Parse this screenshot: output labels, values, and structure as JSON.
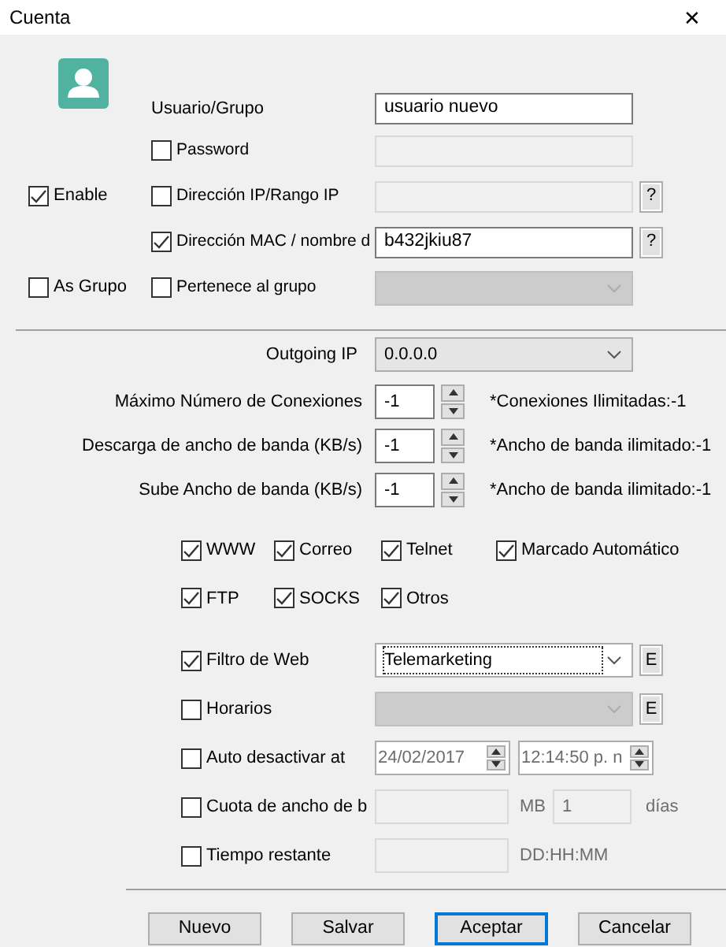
{
  "window": {
    "title": "Cuenta",
    "close": "✕"
  },
  "top_rows": [
    {
      "kind": "user",
      "label": "Usuario/Grupo",
      "value": "usuario nuevo"
    },
    {
      "kind": "field",
      "label": "Password",
      "checked": false
    },
    {
      "kind": "field_help",
      "label": "Dirección IP/Rango IP",
      "checked": false,
      "help": "?",
      "side": {
        "label": "Enable",
        "checked": true
      }
    },
    {
      "kind": "field_help",
      "label": "Dirección MAC / nombre d",
      "checked": true,
      "value": "b432jkiu87",
      "help": "?"
    },
    {
      "kind": "dropdown",
      "label": "Pertenece al grupo",
      "checked": false,
      "side": {
        "label": "As Grupo",
        "checked": false
      }
    }
  ],
  "outgoing_ip": {
    "label": "Outgoing IP",
    "value": "0.0.0.0"
  },
  "limits": [
    {
      "label": "Máximo Número de Conexiones",
      "value": "-1",
      "note": "*Conexiones Ilimitadas:-1"
    },
    {
      "label": "Descarga de ancho de banda (KB/s)",
      "value": "-1",
      "note": "*Ancho de banda ilimitado:-1"
    },
    {
      "label": "Sube Ancho de banda (KB/s)",
      "value": "-1",
      "note": "*Ancho de banda ilimitado:-1"
    }
  ],
  "services": [
    {
      "label": "WWW",
      "checked": true
    },
    {
      "label": "Correo",
      "checked": true
    },
    {
      "label": "Telnet",
      "checked": true
    },
    {
      "label": "Marcado Automático",
      "checked": true
    },
    {
      "label": "FTP",
      "checked": true
    },
    {
      "label": "SOCKS",
      "checked": true
    },
    {
      "label": "Otros",
      "checked": true
    }
  ],
  "lower_rows": [
    {
      "kind": "dropdown_edit",
      "label": "Filtro de Web",
      "checked": true,
      "value": "Telemarketing",
      "edit": "E"
    },
    {
      "kind": "dropdown_edit",
      "label": "Horarios",
      "checked": false,
      "edit": "E"
    },
    {
      "kind": "datetime",
      "label": "Auto desactivar at",
      "checked": false,
      "date": "24/02/2017",
      "time": "12:14:50 p. n"
    },
    {
      "kind": "quota",
      "label": "Cuota de ancho de b",
      "checked": false,
      "unit": "MB",
      "days_value": "1",
      "days_unit": "días"
    },
    {
      "kind": "duration",
      "label": "Tiempo restante",
      "checked": false,
      "unit": "DD:HH:MM"
    }
  ],
  "buttons": [
    {
      "label": "Nuevo",
      "default": false
    },
    {
      "label": "Salvar",
      "default": false
    },
    {
      "label": "Aceptar",
      "default": true
    },
    {
      "label": "Cancelar",
      "default": false
    }
  ]
}
